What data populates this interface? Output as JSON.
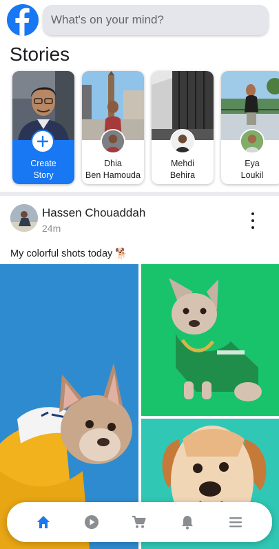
{
  "header": {
    "logo_icon": "facebook-logo-icon",
    "composer_placeholder": "What's on your mind?"
  },
  "stories": {
    "title": "Stories",
    "create": {
      "line1": "Create",
      "line2": "Story",
      "icon": "plus-icon"
    },
    "items": [
      {
        "line1": "Dhia",
        "line2": "Ben Hamouda"
      },
      {
        "line1": "Mehdi",
        "line2": "Behira"
      },
      {
        "line1": "Eya",
        "line2": "Loukil"
      }
    ]
  },
  "post": {
    "author": "Hassen Chouaddah",
    "time": "24m",
    "text": "My colorful shots today 🐕",
    "menu_icon": "more-vertical-icon",
    "photos": [
      "dog-yellow-hoodie",
      "dog-green-jersey",
      "puppy-teal-background"
    ]
  },
  "nav": {
    "items": [
      "home-icon",
      "video-icon",
      "marketplace-cart-icon",
      "notifications-bell-icon",
      "menu-icon"
    ],
    "active": "home-icon"
  },
  "colors": {
    "brand": "#1877f2",
    "nav_icon": "#8a8d91",
    "composer_bg": "#e4e6eb",
    "photo1_bg": "#2e8bd0",
    "photo2_bg": "#18c36b",
    "photo3_bg": "#30c7b5"
  }
}
